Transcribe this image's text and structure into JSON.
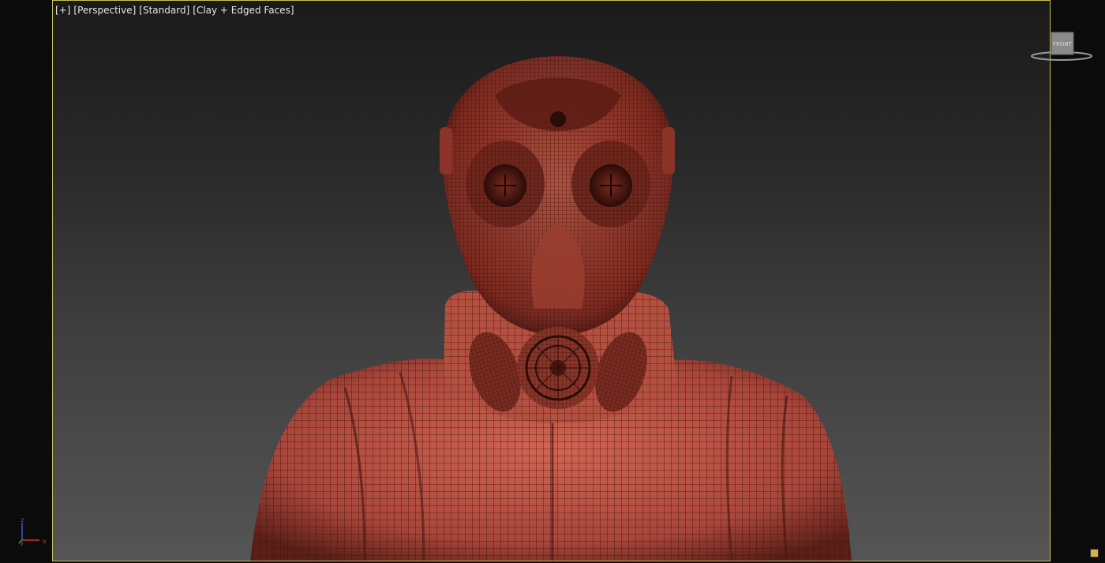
{
  "viewport": {
    "label_parts": [
      "[+]",
      "[Perspective]",
      "[Standard]",
      "[Clay + Edged Faces]"
    ]
  },
  "viewcube": {
    "face_label": "FRONT"
  },
  "axis": {
    "z": "z",
    "y": "y",
    "x": "x"
  },
  "colors": {
    "frame_border": "#c9bf5a",
    "model_base": "#b54a3a",
    "wire": "#3a1410"
  },
  "icons": [
    "viewcube-icon",
    "axis-tripod-icon",
    "maximize-viewport-icon"
  ]
}
